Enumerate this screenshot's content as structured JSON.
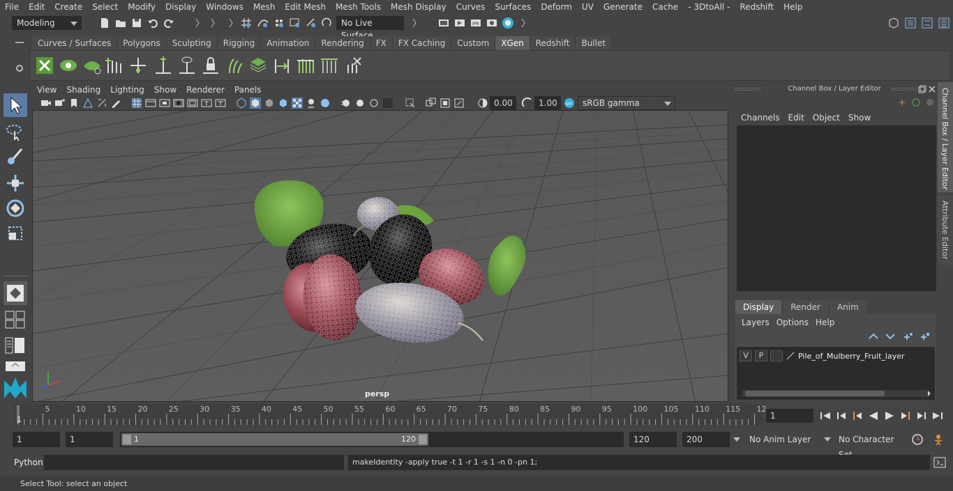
{
  "menubar": {
    "items": [
      "File",
      "Edit",
      "Create",
      "Select",
      "Modify",
      "Display",
      "Windows",
      "Mesh",
      "Edit Mesh",
      "Mesh Tools",
      "Mesh Display",
      "Curves",
      "Surfaces",
      "Deform",
      "UV",
      "Generate",
      "Cache",
      "- 3DtoAll -",
      "Redshift",
      "Help"
    ]
  },
  "statusline": {
    "mode": "Modeling",
    "live_surface": "No Live Surface"
  },
  "shelf": {
    "tabs": [
      "Curves / Surfaces",
      "Polygons",
      "Sculpting",
      "Rigging",
      "Animation",
      "Rendering",
      "FX",
      "FX Caching",
      "Custom",
      "XGen",
      "Redshift",
      "Bullet"
    ],
    "active_tab": "XGen"
  },
  "viewport": {
    "menu": [
      "View",
      "Shading",
      "Lighting",
      "Show",
      "Renderer",
      "Panels"
    ],
    "exposure": "0.00",
    "gamma": "1.00",
    "color_space": "sRGB gamma",
    "camera_label": "persp"
  },
  "channelbox": {
    "title": "Channel Box / Layer Editor",
    "menu": [
      "Channels",
      "Edit",
      "Object",
      "Show"
    ]
  },
  "layereditor": {
    "tabs": [
      "Display",
      "Render",
      "Anim"
    ],
    "active_tab": "Display",
    "menu": [
      "Layers",
      "Options",
      "Help"
    ],
    "layers": [
      {
        "v": "V",
        "p": "P",
        "name": "Pile_of_Mulberry_Fruit_layer"
      }
    ]
  },
  "side_tabs": [
    "Channel Box / Layer Editor",
    "Attribute Editor"
  ],
  "timeline": {
    "ticks": [
      "5",
      "10",
      "15",
      "20",
      "25",
      "30",
      "35",
      "40",
      "45",
      "50",
      "55",
      "60",
      "65",
      "70",
      "75",
      "80",
      "85",
      "90",
      "95",
      "100",
      "105",
      "110",
      "115",
      "12"
    ],
    "start_tick": "1",
    "current_frame": "1"
  },
  "range": {
    "start": "1",
    "playback_start": "1",
    "slider_start": "1",
    "slider_end": "120",
    "playback_end": "120",
    "end": "200",
    "anim_layer": "No Anim Layer",
    "character_set": "No Character Set"
  },
  "commandline": {
    "language": "Python",
    "result": "makeIdentity -apply true -t 1 -r 1 -s 1 -n 0 -pn 1;"
  },
  "helpline": {
    "text": "Select Tool: select an object"
  }
}
